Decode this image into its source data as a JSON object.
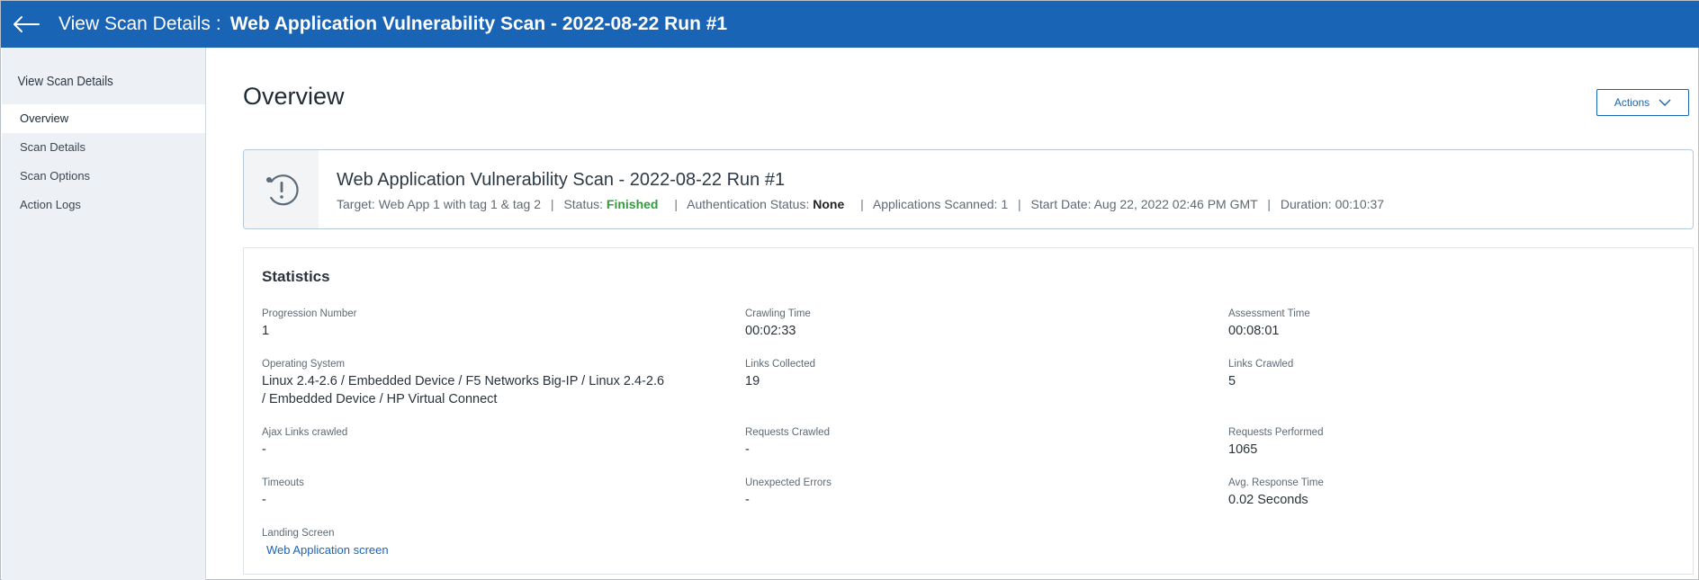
{
  "header": {
    "label": "View Scan Details",
    "separator": ":",
    "title": "Web Application Vulnerability Scan - 2022-08-22 Run #1"
  },
  "sidebar": {
    "title": "View Scan Details",
    "items": [
      {
        "label": "Overview",
        "active": true
      },
      {
        "label": "Scan Details",
        "active": false
      },
      {
        "label": "Scan Options",
        "active": false
      },
      {
        "label": "Action Logs",
        "active": false
      }
    ]
  },
  "page": {
    "title": "Overview",
    "actions_label": "Actions"
  },
  "summary": {
    "title": "Web Application Vulnerability Scan - 2022-08-22 Run #1",
    "target_label": "Target:",
    "target_value": "Web App 1 with tag 1 & tag 2",
    "status_label": "Status:",
    "status_value": "Finished",
    "auth_label": "Authentication Status:",
    "auth_value": "None",
    "apps_label": "Applications Scanned:",
    "apps_value": "1",
    "start_label": "Start Date:",
    "start_value": "Aug 22, 2022 02:46 PM GMT",
    "duration_label": "Duration:",
    "duration_value": "00:10:37",
    "separator": "|"
  },
  "statistics": {
    "title": "Statistics",
    "progression_number": {
      "label": "Progression Number",
      "value": "1"
    },
    "crawling_time": {
      "label": "Crawling Time",
      "value": "00:02:33"
    },
    "assessment_time": {
      "label": "Assessment Time",
      "value": "00:08:01"
    },
    "operating_system": {
      "label": "Operating System",
      "value_line1": "Linux 2.4-2.6 / Embedded Device / F5 Networks Big-IP / Linux 2.4-2.6",
      "value_line2": "/ Embedded Device / HP Virtual Connect"
    },
    "links_collected": {
      "label": "Links Collected",
      "value": "19"
    },
    "links_crawled": {
      "label": "Links Crawled",
      "value": "5"
    },
    "ajax_links_crawled": {
      "label": "Ajax Links crawled",
      "value": "-"
    },
    "requests_crawled": {
      "label": "Requests Crawled",
      "value": "-"
    },
    "requests_performed": {
      "label": "Requests Performed",
      "value": "1065"
    },
    "timeouts": {
      "label": "Timeouts",
      "value": "-"
    },
    "unexpected_errors": {
      "label": "Unexpected Errors",
      "value": "-"
    },
    "avg_response_time": {
      "label": "Avg. Response Time",
      "value": "0.02 Seconds"
    },
    "landing_screen": {
      "label": "Landing Screen",
      "value": "Web Application screen"
    }
  },
  "colors": {
    "header_bg": "#1a64b6",
    "sidebar_bg": "#edf1f6",
    "status_finished": "#2e9d3c",
    "link": "#1a64b6"
  },
  "icons": {
    "back": "arrow-left-icon",
    "summary": "scan-alert-icon",
    "actions": "chevron-down-icon"
  }
}
